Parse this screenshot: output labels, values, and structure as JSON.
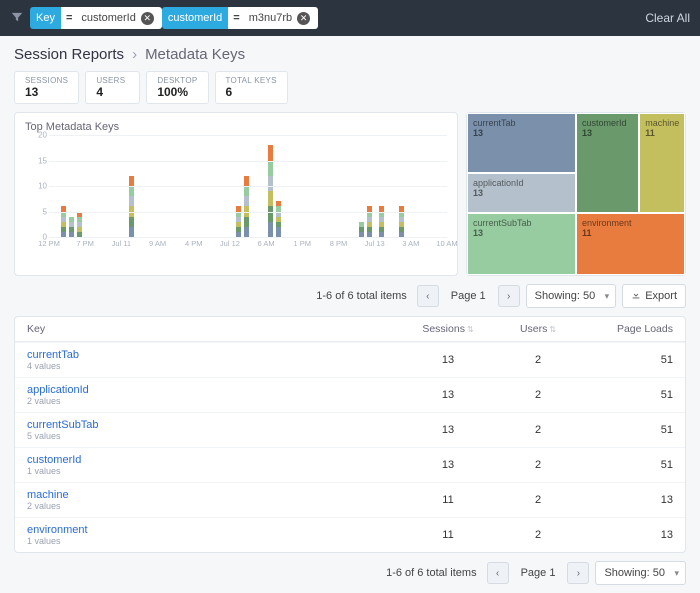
{
  "filters": {
    "chips": [
      {
        "key": "Key",
        "op": "=",
        "value": "customerId"
      },
      {
        "key": "customerId",
        "op": "=",
        "value": "m3nu7rb"
      }
    ],
    "clear_all": "Clear All"
  },
  "breadcrumb": {
    "root": "Session Reports",
    "current": "Metadata Keys"
  },
  "stats": [
    {
      "label": "SESSIONS",
      "value": "13"
    },
    {
      "label": "USERS",
      "value": "4"
    },
    {
      "label": "DESKTOP",
      "value": "100%"
    },
    {
      "label": "TOTAL KEYS",
      "value": "6"
    }
  ],
  "chart_title": "Top Metadata Keys",
  "colors": {
    "currentTab": "#7a90ab",
    "customerId": "#6a9a6c",
    "machine": "#c3be5e",
    "applicationId": "#b4c0cb",
    "currentSubTab": "#97cba0",
    "environment": "#e87b3e"
  },
  "chart_data": {
    "type": "bar",
    "stacked": true,
    "title": "Top Metadata Keys",
    "ylabel": "",
    "xlabel": "",
    "ylim": [
      0,
      20
    ],
    "yticks": [
      0,
      5,
      10,
      15,
      20
    ],
    "xticks": [
      "12 PM",
      "7 PM",
      "Jul 11",
      "9 AM",
      "4 PM",
      "Jul 12",
      "6 AM",
      "1 PM",
      "8 PM",
      "Jul 13",
      "3 AM",
      "10 AM"
    ],
    "series_order": [
      "currentTab",
      "customerId",
      "machine",
      "applicationId",
      "currentSubTab",
      "environment"
    ],
    "bars": [
      {
        "x_pct": 3,
        "stacks": {
          "currentTab": 1,
          "customerId": 1,
          "machine": 1,
          "applicationId": 1,
          "currentSubTab": 1,
          "environment": 1
        }
      },
      {
        "x_pct": 5,
        "stacks": {
          "currentTab": 1,
          "customerId": 1,
          "machine": 0,
          "applicationId": 1,
          "currentSubTab": 1,
          "environment": 0
        }
      },
      {
        "x_pct": 7,
        "stacks": {
          "currentTab": 0,
          "customerId": 1,
          "machine": 1,
          "applicationId": 1,
          "currentSubTab": 1,
          "environment": 1
        }
      },
      {
        "x_pct": 20,
        "stacks": {
          "currentTab": 2,
          "customerId": 2,
          "machine": 2,
          "applicationId": 2,
          "currentSubTab": 2,
          "environment": 2
        }
      },
      {
        "x_pct": 47,
        "stacks": {
          "currentTab": 1,
          "customerId": 1,
          "machine": 1,
          "applicationId": 1,
          "currentSubTab": 1,
          "environment": 1
        }
      },
      {
        "x_pct": 49,
        "stacks": {
          "currentTab": 2,
          "customerId": 2,
          "machine": 2,
          "applicationId": 2,
          "currentSubTab": 2,
          "environment": 2
        }
      },
      {
        "x_pct": 55,
        "stacks": {
          "currentTab": 3,
          "customerId": 3,
          "machine": 3,
          "applicationId": 3,
          "currentSubTab": 3,
          "environment": 3
        }
      },
      {
        "x_pct": 57,
        "stacks": {
          "currentTab": 2,
          "customerId": 1,
          "machine": 1,
          "applicationId": 1,
          "currentSubTab": 1,
          "environment": 1
        }
      },
      {
        "x_pct": 78,
        "stacks": {
          "currentTab": 1,
          "customerId": 1,
          "machine": 0,
          "applicationId": 0,
          "currentSubTab": 1,
          "environment": 0
        }
      },
      {
        "x_pct": 80,
        "stacks": {
          "currentTab": 1,
          "customerId": 1,
          "machine": 1,
          "applicationId": 1,
          "currentSubTab": 1,
          "environment": 1
        }
      },
      {
        "x_pct": 83,
        "stacks": {
          "currentTab": 1,
          "customerId": 1,
          "machine": 1,
          "applicationId": 1,
          "currentSubTab": 1,
          "environment": 1
        }
      },
      {
        "x_pct": 88,
        "stacks": {
          "currentTab": 1,
          "customerId": 1,
          "machine": 1,
          "applicationId": 1,
          "currentSubTab": 1,
          "environment": 1
        }
      }
    ]
  },
  "treemap": [
    {
      "name": "currentTab",
      "value": "13"
    },
    {
      "name": "customerId",
      "value": "13"
    },
    {
      "name": "machine",
      "value": "11"
    },
    {
      "name": "applicationId",
      "value": "13"
    },
    {
      "name": "currentSubTab",
      "value": "13"
    },
    {
      "name": "environment",
      "value": "11"
    }
  ],
  "pager": {
    "info": "1-6 of 6 total items",
    "page_label": "Page 1",
    "showing_label": "Showing: 50",
    "export_label": "Export"
  },
  "table": {
    "headers": {
      "key": "Key",
      "sessions": "Sessions",
      "users": "Users",
      "page_loads": "Page Loads"
    },
    "rows": [
      {
        "key": "currentTab",
        "sub": "4 values",
        "sessions": "13",
        "users": "2",
        "page_loads": "51"
      },
      {
        "key": "applicationId",
        "sub": "2 values",
        "sessions": "13",
        "users": "2",
        "page_loads": "51"
      },
      {
        "key": "currentSubTab",
        "sub": "5 values",
        "sessions": "13",
        "users": "2",
        "page_loads": "51"
      },
      {
        "key": "customerId",
        "sub": "1 values",
        "sessions": "13",
        "users": "2",
        "page_loads": "51"
      },
      {
        "key": "machine",
        "sub": "2 values",
        "sessions": "11",
        "users": "2",
        "page_loads": "13"
      },
      {
        "key": "environment",
        "sub": "1 values",
        "sessions": "11",
        "users": "2",
        "page_loads": "13"
      }
    ]
  }
}
